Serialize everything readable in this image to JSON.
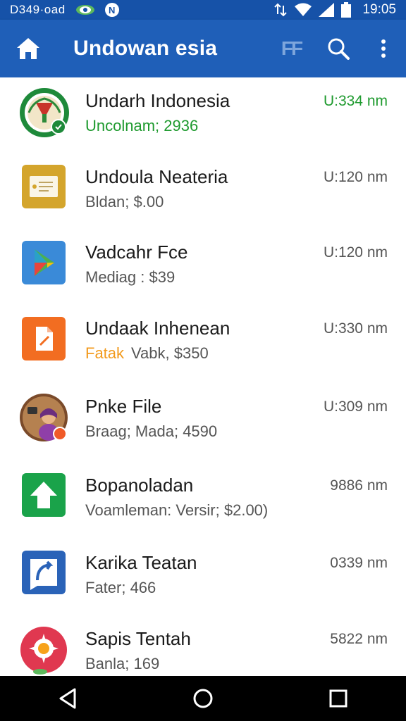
{
  "status_bar": {
    "left_text": "D349·oad",
    "time": "19:05",
    "notification_letter": "N"
  },
  "app_bar": {
    "title": "Undowan esia",
    "ff_label": "FF",
    "icons": [
      "home-icon",
      "search-icon",
      "more-vert-icon"
    ]
  },
  "apps": [
    {
      "title": "Undarh Indonesia",
      "subtitle": "Uncolnam; 2936",
      "size": "U:334 nm",
      "subtitle_color": "#1e9a2e",
      "size_color": "#1e9a2e",
      "icon": "emblem-icon"
    },
    {
      "title": "Undoula Neateria",
      "subtitle": "Bldan; $.00",
      "size": "U:120 nm",
      "icon": "document-icon"
    },
    {
      "title": "Vadcahr Fce",
      "subtitle": "Mediag : $39",
      "size": "U:120 nm",
      "icon": "play-store-icon"
    },
    {
      "title": "Undaak Inhenean",
      "subtitle_accent": "Fatak",
      "subtitle": "Vabk, $350",
      "size": "U:330 nm",
      "accent_color": "#f29a1c",
      "icon": "file-icon"
    },
    {
      "title": "Pnke File",
      "subtitle": "Braag; Mada; 4590",
      "size": "U:309 nm",
      "icon": "avatar-icon"
    },
    {
      "title": "Bopanoladan",
      "subtitle": "Voamleman: Versir; $2.00)",
      "size": "9886 nm",
      "icon": "upload-icon"
    },
    {
      "title": "Karika Teatan",
      "subtitle": "Fater; 466",
      "size": "0339 nm",
      "icon": "chat-icon"
    },
    {
      "title": "Sapis Tentah",
      "subtitle": "Banla; 169",
      "size": "5822 nm",
      "icon": "flower-icon"
    }
  ],
  "nav_bar": {
    "icons": [
      "back-icon",
      "home-circle-icon",
      "recents-icon"
    ]
  },
  "colors": {
    "app_bar": "#1f5fb8",
    "status_bar": "#1652a8",
    "green_accent": "#1e9a2e",
    "orange_accent": "#f29a1c"
  }
}
